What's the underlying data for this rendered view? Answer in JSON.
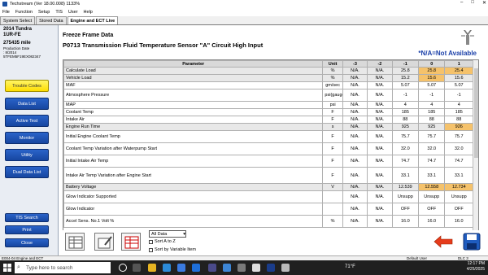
{
  "window": {
    "title": "Techstream (Ver 18.00.008)   1133%",
    "controls": [
      "–",
      "□",
      "✕"
    ]
  },
  "menu": [
    "File",
    "Function",
    "Setup",
    "TIS",
    "User",
    "Help"
  ],
  "tabs": [
    "System Select",
    "Stored Data",
    "Engine and ECT Live"
  ],
  "vehicle": {
    "model": "2014 Tundra",
    "engine": "1UR-FE",
    "mileage": "275435 mile",
    "production_label": "Production Date",
    "production_date": ": 8/2014",
    "vin": "5TFEM5F19EX082347"
  },
  "sidebar_buttons": [
    "Trouble Codes",
    "Data List",
    "Active Test",
    "Monitor",
    "Utility",
    "Dual Data List"
  ],
  "sidebar_bottom_buttons": [
    "TIS Search",
    "Print",
    "Close"
  ],
  "freeze_frame_title": "Freeze Frame Data",
  "dtc_title": "P0713 Transmission Fluid Temperature Sensor \"A\" Circuit High Input",
  "na_note": "*N/A=Not Available",
  "table": {
    "headers": [
      "Parameter",
      "Unit",
      "-3",
      "-2",
      "-1",
      "0",
      "1"
    ],
    "rows": [
      {
        "p": "Calculate Load",
        "u": "%",
        "v": [
          "N/A.",
          "N/A.",
          "25.8",
          "25.8",
          "25.4"
        ]
      },
      {
        "p": "Vehicle Load",
        "u": "%",
        "v": [
          "N/A.",
          "N/A.",
          "15.2",
          "15.6",
          "15.6"
        ]
      },
      {
        "p": "MAF",
        "u": "gm/sec",
        "v": [
          "N/A.",
          "N/A.",
          "5.07",
          "5.07",
          "5.07"
        ]
      },
      {
        "p": "Atmosphere Pressure",
        "u": "psi(gauge)",
        "v": [
          "N/A.",
          "N/A.",
          "-1",
          "-1",
          "-1"
        ]
      },
      {
        "p": "MAP",
        "u": "psi",
        "v": [
          "N/A.",
          "N/A.",
          "4",
          "4",
          "4"
        ]
      },
      {
        "p": "Coolant Temp",
        "u": "F",
        "v": [
          "N/A.",
          "N/A.",
          "185",
          "185",
          "185"
        ]
      },
      {
        "p": "Intake Air",
        "u": "F",
        "v": [
          "N/A.",
          "N/A.",
          "88",
          "88",
          "88"
        ]
      },
      {
        "p": "Engine Run Time",
        "u": "s",
        "v": [
          "N/A.",
          "N/A.",
          "925",
          "925",
          "926"
        ]
      },
      {
        "p": "Initial Engine Coolant Temp",
        "u": "F",
        "v": [
          "N/A.",
          "N/A.",
          "75.7",
          "75.7",
          "75.7"
        ]
      },
      {
        "p": "Coolant Temp Variation after Waterpump Start",
        "u": "F",
        "v": [
          "N/A.",
          "N/A.",
          "32.0",
          "32.0",
          "32.0"
        ]
      },
      {
        "p": "Initial Intake Air Temp",
        "u": "F",
        "v": [
          "N/A.",
          "N/A.",
          "74.7",
          "74.7",
          "74.7"
        ]
      },
      {
        "p": "Intake Air Temp Variation after Engine Start",
        "u": "F",
        "v": [
          "N/A.",
          "N/A.",
          "33.1",
          "33.1",
          "33.1"
        ]
      },
      {
        "p": "Battery Voltage",
        "u": "V",
        "v": [
          "N/A.",
          "N/A.",
          "12.539",
          "12.558",
          "12.734"
        ]
      },
      {
        "p": "Glow Indicator Supported",
        "u": "",
        "v": [
          "N/A.",
          "N/A.",
          "Unsupp",
          "Unsupp",
          "Unsupp"
        ]
      },
      {
        "p": "Glow Indicator",
        "u": "",
        "v": [
          "N/A.",
          "N/A.",
          "OFF",
          "OFF",
          "OFF"
        ]
      },
      {
        "p": "Accel Sens. No.1 Volt %",
        "u": "%",
        "v": [
          "N/A.",
          "N/A.",
          "16.0",
          "16.0",
          "16.0"
        ]
      }
    ]
  },
  "filter": {
    "selected": "All Data",
    "sort_a_to_z": "Sort A to Z",
    "sort_by_variable": "Sort by Variable Item"
  },
  "status": {
    "left": "E004-04   Engine and ECT",
    "mid": "Default User",
    "right": "DLC 3"
  },
  "taskbar": {
    "search_placeholder": "Type here to search",
    "weather": "71°F",
    "time": "12:17 PM",
    "date": "4/25/2025"
  },
  "colors": {
    "accent_blue": "#1746a0",
    "highlight_orange": "#f5c26b",
    "yellow_button": "#ffdd00"
  }
}
